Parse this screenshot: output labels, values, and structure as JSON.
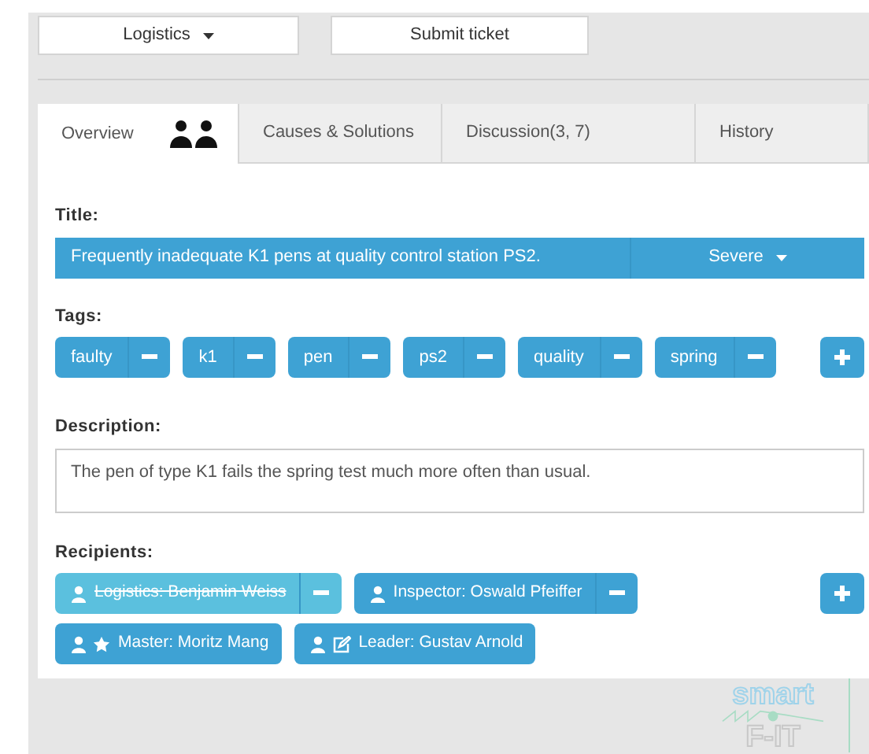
{
  "toolbar": {
    "department": "Logistics",
    "submit": "Submit ticket"
  },
  "tabs": [
    {
      "label": "Overview",
      "selected": true,
      "has_badge_icon": true
    },
    {
      "label": "Causes & Solutions",
      "selected": false,
      "has_badge_icon": false
    },
    {
      "label": "Discussion(3, 7)",
      "selected": false,
      "has_badge_icon": false
    },
    {
      "label": "History",
      "selected": false,
      "has_badge_icon": false
    }
  ],
  "title_label": "Title:",
  "title": "Frequently inadequate K1 pens at quality control station PS2.",
  "severity": "Severe",
  "tags_label": "Tags:",
  "tags": [
    "faulty",
    "k1",
    "pen",
    "ps2",
    "quality",
    "spring"
  ],
  "description_label": "Description:",
  "description": "The pen of type K1 fails the spring test much more often than usual.",
  "recipients_label": "Recipients:",
  "recipients": [
    {
      "label": "Logistics: Benjamin Weiss",
      "kind": "person",
      "removed": true,
      "removable": true
    },
    {
      "label": "Inspector: Oswald Pfeiffer",
      "kind": "person",
      "removed": false,
      "removable": true
    },
    {
      "label": "Master: Moritz Mang",
      "kind": "master",
      "removed": false,
      "removable": false
    },
    {
      "label": "Leader: Gustav Arnold",
      "kind": "leader",
      "removed": false,
      "removable": false
    }
  ],
  "logo": {
    "top": "smart",
    "bottom": "F-IT"
  }
}
